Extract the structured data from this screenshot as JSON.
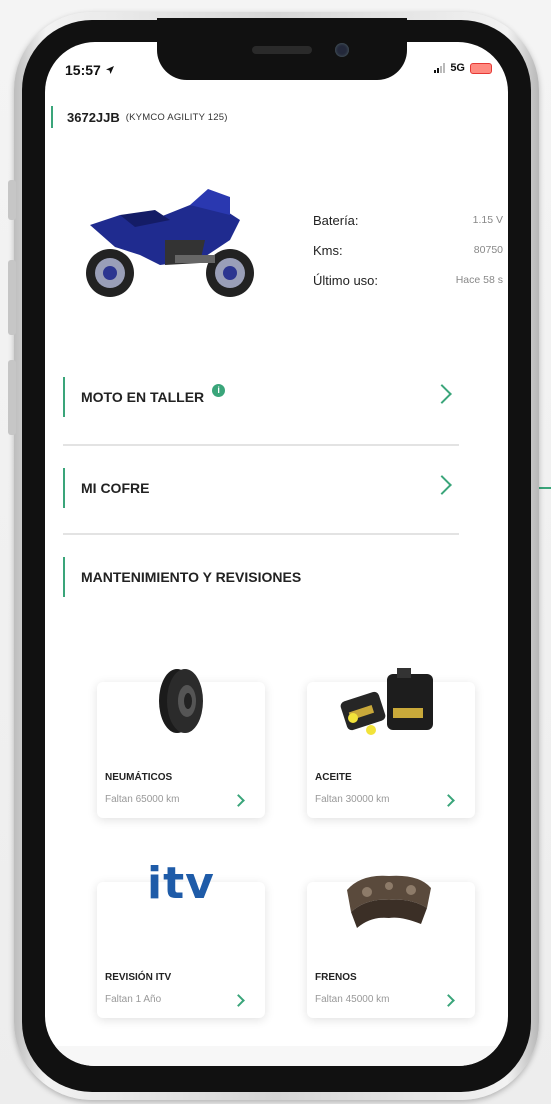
{
  "status_bar": {
    "time": "15:57",
    "network": "5G"
  },
  "vehicle": {
    "plate": "3672JJB",
    "model": "(KYMCO AGILITY 125)"
  },
  "stats": [
    {
      "label": "Batería:",
      "value": "1.15 V"
    },
    {
      "label": "Kms:",
      "value": "80750"
    },
    {
      "label": "Último uso:",
      "value": "Hace 58 s"
    }
  ],
  "menu": {
    "taller": "MOTO EN TALLER",
    "taller_badge": "i",
    "cofre": "MI COFRE",
    "mantenimiento": "MANTENIMIENTO Y REVISIONES"
  },
  "cards": {
    "neumaticos": {
      "title": "NEUMÁTICOS",
      "subtitle": "Faltan 65000 km"
    },
    "aceite": {
      "title": "ACEITE",
      "subtitle": "Faltan 30000 km"
    },
    "itv": {
      "title": "REVISIÓN ITV",
      "subtitle": "Faltan 1 Año",
      "logo": "itv"
    },
    "frenos": {
      "title": "FRENOS",
      "subtitle": "Faltan 45000 km"
    }
  },
  "colors": {
    "accent": "#3aa57a",
    "moto_blue": "#1f2b8f",
    "itv_blue": "#1e5ba8"
  }
}
